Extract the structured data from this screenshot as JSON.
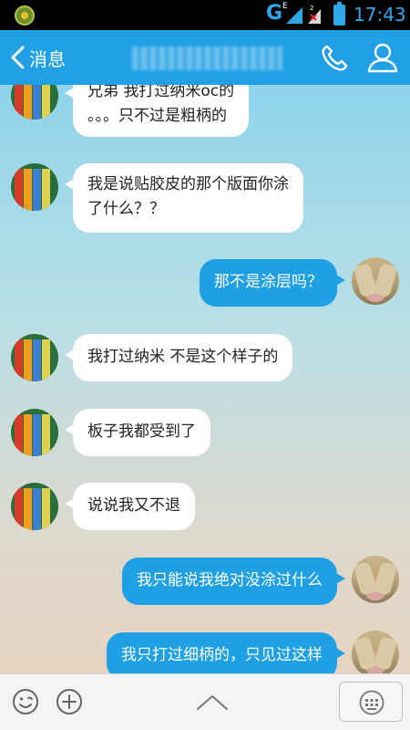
{
  "status_bar": {
    "network": "G",
    "signal_sub": "E",
    "time": "17:43",
    "colors": {
      "accent": "#2da8e6"
    }
  },
  "header": {
    "back_label": "消息",
    "contact_name": "",
    "back_icon": "chevron-left-icon",
    "call_icon": "phone-icon",
    "profile_icon": "person-icon"
  },
  "messages": [
    {
      "side": "in",
      "lines": [
        "兄弟 我打过纳米oc的",
        "。。。只不过是粗柄的"
      ]
    },
    {
      "side": "in",
      "lines": [
        "我是说贴胶皮的那个版面你涂",
        "了什么？？"
      ]
    },
    {
      "side": "out",
      "lines": [
        "那不是涂层吗？"
      ]
    },
    {
      "side": "in",
      "lines": [
        "我打过纳米 不是这个样子的"
      ]
    },
    {
      "side": "in",
      "lines": [
        "板子我都受到了"
      ]
    },
    {
      "side": "in",
      "lines": [
        "说说我又不退"
      ]
    },
    {
      "side": "out",
      "lines": [
        "我只能说我绝对没涂过什么"
      ]
    },
    {
      "side": "out",
      "lines": [
        "我只打过细柄的，只见过这样"
      ]
    }
  ],
  "input_bar": {
    "emoji_icon": "emoji-icon",
    "plus_icon": "plus-circle-icon",
    "expand_icon": "chevron-up-icon",
    "keyboard_icon": "keyboard-icon"
  },
  "colors": {
    "header_bg": "#21a0e5",
    "bubble_out": "#1f9fe4",
    "bubble_in": "#ffffff"
  }
}
